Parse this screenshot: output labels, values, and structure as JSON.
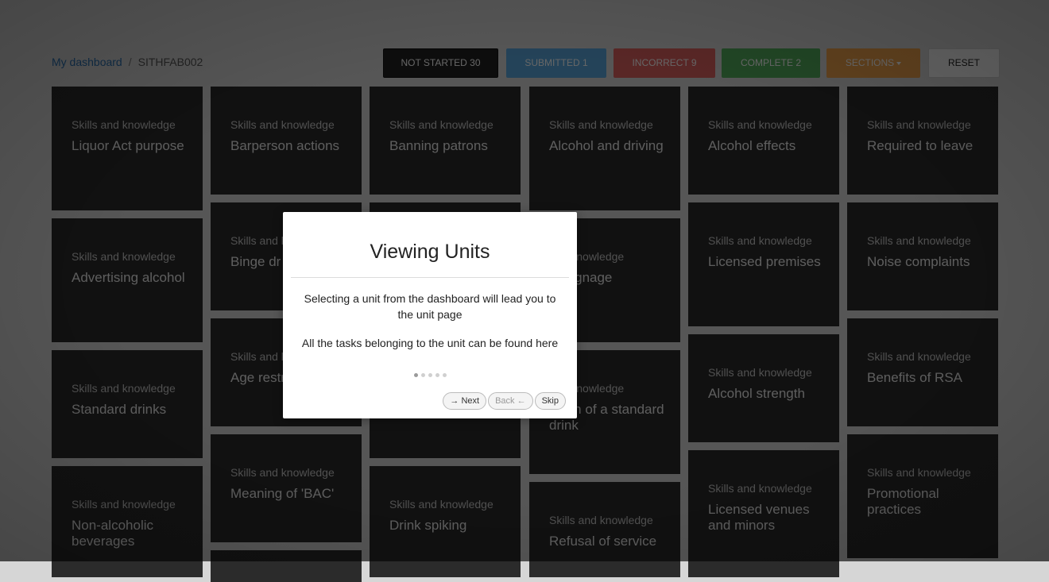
{
  "breadcrumb": {
    "home": "My dashboard",
    "separator": "/",
    "current": "SITHFAB002"
  },
  "toolbar": {
    "not_started": "NOT STARTED 30",
    "submitted": "SUBMITTED 1",
    "incorrect": "INCORRECT 9",
    "complete": "COMPLETE 2",
    "sections": "SECTIONS",
    "reset": "RESET"
  },
  "cards": [
    {
      "category": "Skills and knowledge",
      "title": "Liquor Act purpose"
    },
    {
      "category": "Skills and knowledge",
      "title": "Barperson actions"
    },
    {
      "category": "Skills and knowledge",
      "title": "Banning patrons"
    },
    {
      "category": "Skills and knowledge",
      "title": "Alcohol and driving"
    },
    {
      "category": "Skills and knowledge",
      "title": "Alcohol effects"
    },
    {
      "category": "Skills and knowledge",
      "title": "Required to leave"
    },
    {
      "category": "Skills and knowledge",
      "title": "Advertising alcohol"
    },
    {
      "category": "Skills and k",
      "title": "Binge dr"
    },
    {
      "category": "",
      "title": ""
    },
    {
      "category": "and knowledge",
      "title": "or signage"
    },
    {
      "category": "Skills and knowledge",
      "title": "Licensed premises"
    },
    {
      "category": "Skills and knowledge",
      "title": "Noise complaints"
    },
    {
      "category": "Skills and knowledge",
      "title": "Standard drinks"
    },
    {
      "category": "Skills and k",
      "title": "Age restr"
    },
    {
      "category": "",
      "title": ""
    },
    {
      "category": "and knowledge",
      "title": "nition of a standard drink"
    },
    {
      "category": "Skills and knowledge",
      "title": "Alcohol strength"
    },
    {
      "category": "Skills and knowledge",
      "title": "Benefits of RSA"
    },
    {
      "category": "Skills and knowledge",
      "title": "Non-alcoholic beverages"
    },
    {
      "category": "Skills and knowledge",
      "title": "Meaning of 'BAC'"
    },
    {
      "category": "Skills and knowledge",
      "title": "Drink spiking"
    },
    {
      "category": "Skills and knowledge",
      "title": "Refusal of service"
    },
    {
      "category": "Skills and knowledge",
      "title": "Licensed venues and minors"
    },
    {
      "category": "Skills and knowledge",
      "title": "Promotional practices"
    },
    {
      "category": "",
      "title": ""
    }
  ],
  "modal": {
    "title": "Viewing Units",
    "text1": "Selecting a unit from the dashboard will lead you to the unit page",
    "text2": "All the tasks belonging to the unit can be found here",
    "steps_total": 5,
    "step_current": 1,
    "next": "→ Next",
    "back": "Back ←",
    "skip": "Skip"
  }
}
